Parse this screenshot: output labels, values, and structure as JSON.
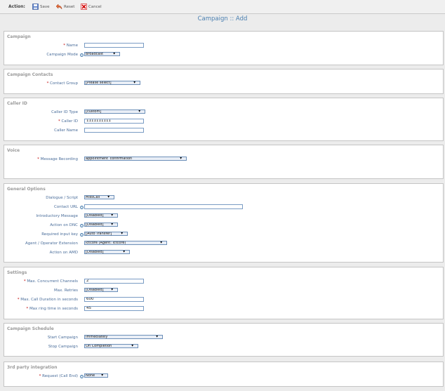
{
  "toolbar": {
    "action_label": "Action:",
    "save_label": "Save",
    "reset_label": "Reset",
    "cancel_label": "Cancel"
  },
  "page": {
    "title": "Campaign :: Add"
  },
  "sections": {
    "campaign": {
      "title": "Campaign",
      "name_label": "Name",
      "name_value": "",
      "mode_label": "Campaign Mode",
      "mode_value": "Broadcast"
    },
    "contacts": {
      "title": "Campaign Contacts",
      "group_label": "Contact Group",
      "group_value": "[Please select]"
    },
    "callerid": {
      "title": "Caller ID",
      "type_label": "Caller ID Type",
      "type_value": "[custom]",
      "id_label": "Caller ID",
      "id_value": "1111111111",
      "name_label": "Caller Name",
      "name_value": ""
    },
    "voice": {
      "title": "Voice",
      "recording_label": "Message Recording",
      "recording_value": "appointment_confirmation"
    },
    "general": {
      "title": "General Options",
      "dialogue_label": "Dialogue / Script",
      "dialogue_value": "MissCall",
      "url_label": "Contact URL",
      "url_value": "",
      "intro_label": "Introductory Message",
      "intro_value": "[Disabled]",
      "dnc_label": "Action on DNC",
      "dnc_value": "[Disabled]",
      "key_label": "Required input key",
      "key_value": "[Auto Transfer]",
      "agent_label": "Agent / Operator Extension",
      "agent_value": "ictcore (Agent: ictcore)",
      "amd_label": "Action on AMD",
      "amd_value": "[Disabled]"
    },
    "settings": {
      "title": "Settings",
      "concurrent_label": "Max. Concurrent Channels",
      "concurrent_value": "2",
      "retries_label": "Max. Retries",
      "retries_value": "[Disabled]",
      "duration_label": "Max. Call Duration in seconds",
      "duration_value": "600",
      "ring_label": "Max ring time in seconds",
      "ring_value": "45"
    },
    "schedule": {
      "title": "Campaign Schedule",
      "start_label": "Start Campaign",
      "start_value": "Immediately",
      "stop_label": "Stop Campaign",
      "stop_value": "On Completion"
    },
    "integration": {
      "title": "3rd party integration",
      "request_label": "Request (Call End)",
      "request_value": "None"
    }
  },
  "required_mark": "*",
  "help_mark": "?",
  "dropdown_arrow": "▼"
}
